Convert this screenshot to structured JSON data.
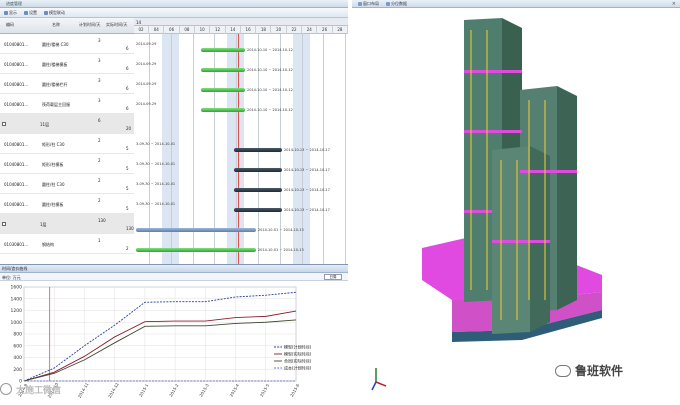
{
  "left_window": {
    "title": "进度管理",
    "toolbar": [
      "显示",
      "设置",
      "模型联动"
    ]
  },
  "task_table": {
    "columns": [
      "编码",
      "名称",
      "计划时间/天",
      "实际时间/天"
    ],
    "rows": [
      {
        "code": "01040801...",
        "name": "圆柱/楼梯 C30",
        "plan": "3",
        "actual": "6",
        "summary": false
      },
      {
        "code": "01040801...",
        "name": "圆柱/楼梯模板",
        "plan": "3",
        "actual": "6",
        "summary": false
      },
      {
        "code": "01040801...",
        "name": "圆柱/楼梯栏杆",
        "plan": "3",
        "actual": "6",
        "summary": false
      },
      {
        "code": "01040801...",
        "name": "筏荷载层主回服",
        "plan": "3",
        "actual": "6",
        "summary": false
      },
      {
        "code": "",
        "name": "11层",
        "plan": "6",
        "actual": "20",
        "summary": true
      },
      {
        "code": "01040801...",
        "name": "矩形/柱 C30",
        "plan": "2",
        "actual": "5",
        "summary": false
      },
      {
        "code": "01040801...",
        "name": "矩形/柱模板",
        "plan": "2",
        "actual": "5",
        "summary": false
      },
      {
        "code": "01040801...",
        "name": "圆柱/柱 C30",
        "plan": "2",
        "actual": "5",
        "summary": false
      },
      {
        "code": "01040801...",
        "name": "圆柱/柱模板",
        "plan": "2",
        "actual": "5",
        "summary": false
      },
      {
        "code": "",
        "name": "1层",
        "plan": "130",
        "actual": "130",
        "summary": true
      },
      {
        "code": "01030801...",
        "name": "钢结构",
        "plan": "1",
        "actual": "2",
        "summary": false
      }
    ]
  },
  "gantt": {
    "top_label": "14",
    "days": [
      "02",
      "04",
      "06",
      "08",
      "10",
      "12",
      "14",
      "16",
      "18",
      "20",
      "22",
      "24",
      "26",
      "28"
    ],
    "bars": [
      {
        "row": 0,
        "kind": "green",
        "start": 3.0,
        "len": 2.0,
        "label_left": "2014-09-29",
        "label_right": "2014-10-10 ~ 2014-10-12"
      },
      {
        "row": 1,
        "kind": "green",
        "start": 3.0,
        "len": 2.0,
        "label_left": "2014-09-29",
        "label_right": "2014-10-10 ~ 2014-10-12"
      },
      {
        "row": 2,
        "kind": "green",
        "start": 3.0,
        "len": 2.0,
        "label_left": "2014-09-29",
        "label_right": "2014-10-10 ~ 2014-10-12"
      },
      {
        "row": 3,
        "kind": "green",
        "start": 3.0,
        "len": 2.0,
        "label_left": "2014-09-29",
        "label_right": "2014-10-10 ~ 2014-10-12"
      },
      {
        "row": 5,
        "kind": "dark",
        "start": 4.5,
        "len": 2.2,
        "label_left": "3-09-30 ~ 2014-10-01",
        "label_right": "2014-10-13 ~ 2014-10-17"
      },
      {
        "row": 6,
        "kind": "dark",
        "start": 4.5,
        "len": 2.2,
        "label_left": "3-09-30 ~ 2014-10-01",
        "label_right": "2014-10-13 ~ 2014-10-17"
      },
      {
        "row": 7,
        "kind": "dark",
        "start": 4.5,
        "len": 2.2,
        "label_left": "3-09-30 ~ 2014-10-01",
        "label_right": "2014-10-13 ~ 2014-10-17"
      },
      {
        "row": 8,
        "kind": "dark",
        "start": 4.5,
        "len": 2.2,
        "label_left": "3-09-30 ~ 2014-10-01",
        "label_right": "2014-10-13 ~ 2014-10-17"
      },
      {
        "row": 9,
        "kind": "blue",
        "start": 0.0,
        "len": 5.5,
        "label_left": "",
        "label_right": "2014-10-01 ~ 2014-10-13"
      },
      {
        "row": 10,
        "kind": "green",
        "start": 0.0,
        "len": 5.5,
        "label_left": "",
        "label_right": "2014-10-01 ~ 2014-10-13"
      }
    ]
  },
  "curve_panel": {
    "title": "时间/造价曲线",
    "unit_label": "单位: 万元",
    "select_value": "日周"
  },
  "chart_data": {
    "type": "line",
    "title": "",
    "ylabel": "",
    "xlabel": "",
    "ylim": [
      0,
      1600
    ],
    "yticks": [
      0,
      200,
      400,
      600,
      800,
      1000,
      1200,
      1400,
      1600
    ],
    "categories": [
      "2014-9",
      "2014-10",
      "2014-11",
      "2014-12",
      "2015-1",
      "2015-2",
      "2015-3",
      "2015-4",
      "2015-5",
      "2015-6"
    ],
    "x_tick_labels": [
      "2014-9",
      "2014-10",
      "2014-11",
      "2014-12",
      "2015-1",
      "2015-2",
      "2015-3",
      "2015-4",
      "2015-5",
      "2015-6"
    ],
    "series": [
      {
        "name": "模型(计划时间)",
        "color": "#2b3f9a",
        "dashed": true,
        "values": [
          0,
          220,
          600,
          950,
          1340,
          1350,
          1350,
          1430,
          1460,
          1510
        ]
      },
      {
        "name": "模型(实际时间)",
        "color": "#8a2030",
        "dashed": false,
        "values": [
          0,
          150,
          420,
          750,
          1010,
          1020,
          1020,
          1080,
          1100,
          1190
        ]
      },
      {
        "name": "合同(实际时间)",
        "color": "#3b4a30",
        "dashed": false,
        "values": [
          0,
          130,
          360,
          650,
          930,
          940,
          940,
          980,
          1000,
          1040
        ]
      },
      {
        "name": "成本(计划时间)",
        "color": "#6a7bc0",
        "dashed": true,
        "values": [
          0,
          0,
          0,
          0,
          0,
          0,
          0,
          0,
          0,
          0
        ]
      }
    ],
    "marker_x": "2014-10",
    "legend_position": "bottom-right"
  },
  "right_window": {
    "tabs": [
      "窗口布局",
      "分位数据"
    ],
    "close_glyph": "×"
  },
  "watermarks": {
    "left": "大施工微信",
    "right": "鲁班软件"
  },
  "colors": {
    "tower_green": "#4f7d6e",
    "tower_pink": "#e04ae0",
    "tower_yellow": "#d8c23a",
    "today_line": "#d9534f"
  }
}
